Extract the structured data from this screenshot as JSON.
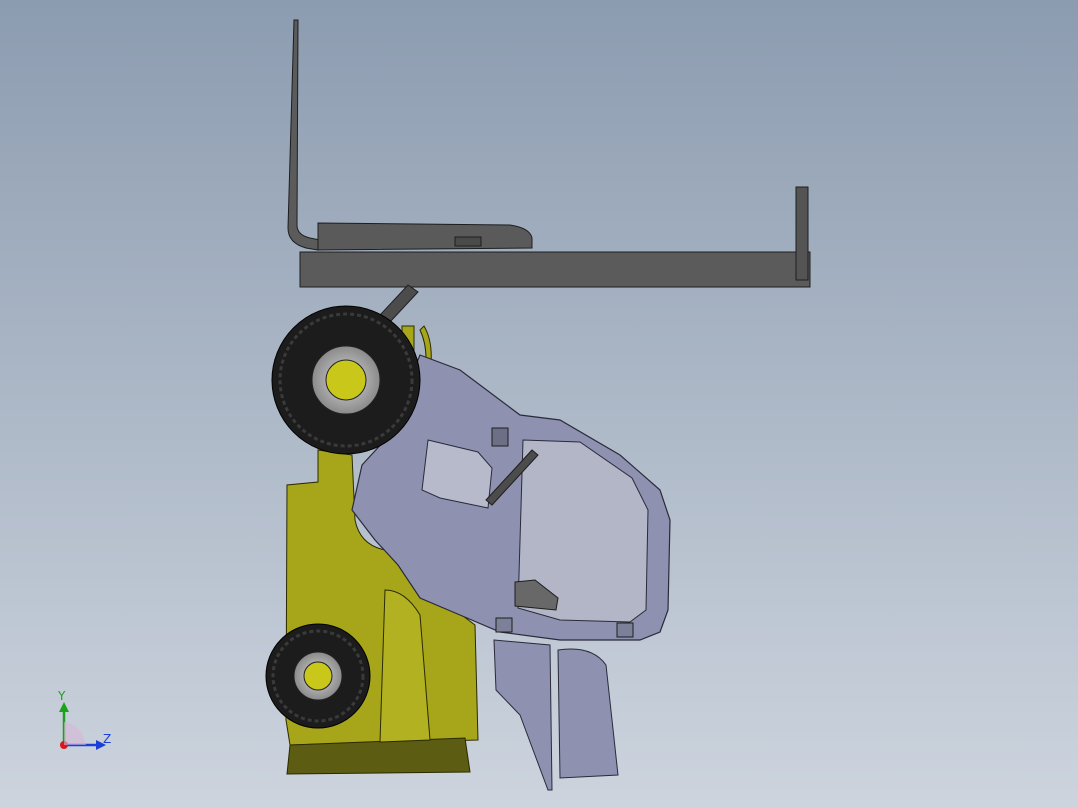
{
  "viewport": {
    "background_top": "#8c9cb0",
    "background_bottom": "#cdd4de"
  },
  "model": {
    "body_color": "#a7a61a",
    "cab_color": "#8e92b0",
    "fork_color": "#5b5b5b",
    "tire_color": "#1c1c1c"
  },
  "triad": {
    "y_label": "Y",
    "z_label": "Z",
    "y_color": "#1aa31a",
    "z_color": "#1a3fd6",
    "x_color": "#d61a1a"
  }
}
